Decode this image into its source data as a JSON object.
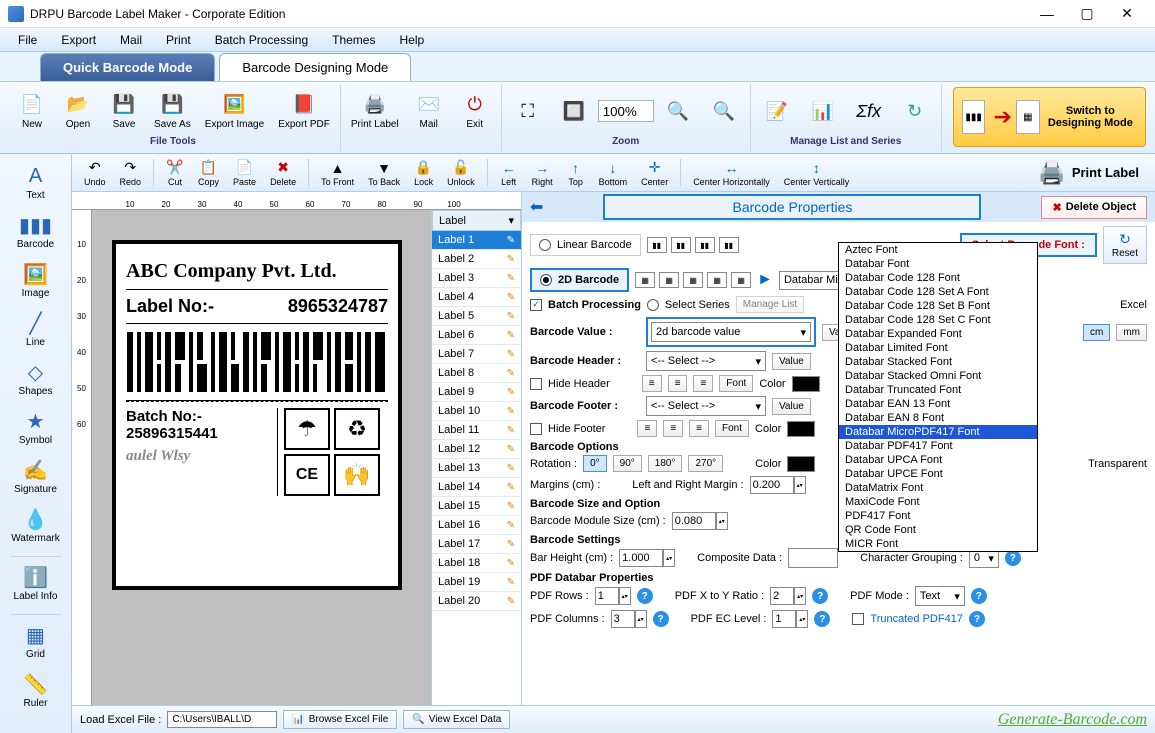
{
  "app": {
    "title": "DRPU Barcode Label Maker - Corporate Edition"
  },
  "menubar": [
    "File",
    "Export",
    "Mail",
    "Print",
    "Batch Processing",
    "Themes",
    "Help"
  ],
  "modetabs": {
    "quick": "Quick Barcode Mode",
    "design": "Barcode Designing Mode"
  },
  "ribbon": {
    "new": "New",
    "open": "Open",
    "save": "Save",
    "saveas": "Save As",
    "exportimg": "Export Image",
    "exportpdf": "Export PDF",
    "printlabel": "Print Label",
    "mail": "Mail",
    "exit": "Exit",
    "filetools": "File Tools",
    "zoom": "Zoom",
    "zoomval": "100%",
    "managelist": "Manage List and Series",
    "switch": "Switch to Designing Mode"
  },
  "toolbar2": {
    "undo": "Undo",
    "redo": "Redo",
    "cut": "Cut",
    "copy": "Copy",
    "paste": "Paste",
    "delete": "Delete",
    "tofront": "To Front",
    "toback": "To Back",
    "lock": "Lock",
    "unlock": "Unlock",
    "left": "Left",
    "right": "Right",
    "top": "Top",
    "bottom": "Bottom",
    "center": "Center",
    "centerh": "Center Horizontally",
    "centerv": "Center Vertically",
    "printlabel": "Print Label"
  },
  "lefttools": [
    "Text",
    "Barcode",
    "Image",
    "Line",
    "Shapes",
    "Symbol",
    "Signature",
    "Watermark",
    "Label Info",
    "Grid",
    "Ruler"
  ],
  "ruler_h": [
    "10",
    "20",
    "30",
    "40",
    "50",
    "60",
    "70",
    "80",
    "90",
    "100"
  ],
  "ruler_v": [
    "10",
    "20",
    "30",
    "40",
    "50",
    "60"
  ],
  "label": {
    "company": "ABC Company Pvt. Ltd.",
    "labelno_lbl": "Label No:-",
    "labelno": "8965324787",
    "batchno_lbl": "Batch No:-",
    "batchno": "25896315441"
  },
  "labellist": {
    "header": "Label",
    "items": [
      "Label 1",
      "Label 2",
      "Label 3",
      "Label 4",
      "Label 5",
      "Label 6",
      "Label 7",
      "Label 8",
      "Label 9",
      "Label 10",
      "Label 11",
      "Label 12",
      "Label 13",
      "Label 14",
      "Label 15",
      "Label 16",
      "Label 17",
      "Label 18",
      "Label 19",
      "Label 20"
    ],
    "selected": 0
  },
  "props": {
    "title": "Barcode Properties",
    "delete": "Delete Object",
    "linear": "Linear Barcode",
    "twod": "2D Barcode",
    "selectfont": "Select Barcode Font :",
    "fontcombo": "Databar MicroPDF417 Font",
    "reset": "Reset",
    "batch": "Batch Processing",
    "selseries": "Select Series",
    "managelist": "Manage List",
    "excel": "Excel",
    "barcodeval_lbl": "Barcode Value :",
    "barcodeval": "2d barcode value",
    "header_lbl": "Barcode Header :",
    "header_sel": "<-- Select -->",
    "footer_lbl": "Barcode Footer :",
    "footer_sel": "<-- Select -->",
    "hideheader": "Hide Header",
    "hidefooter": "Hide Footer",
    "font": "Font",
    "color": "Color",
    "value": "Value",
    "options": "Barcode Options",
    "rotation": "Rotation :",
    "rot0": "0°",
    "rot90": "90°",
    "rot180": "180°",
    "rot270": "270°",
    "transparent": "Transparent",
    "margins_lbl": "Margins (cm) :",
    "margins_side": "Left and Right Margin :",
    "margins_val": "0.200",
    "cm": "cm",
    "mm": "mm",
    "size": "Barcode Size and Option",
    "modsize": "Barcode Module Size (cm) :",
    "modsize_val": "0.080",
    "settings": "Barcode Settings",
    "barheight": "Bar Height (cm) :",
    "barheight_val": "1.000",
    "compdata": "Composite Data :",
    "chargroup": "Character Grouping :",
    "chargroup_val": "0",
    "pdfprops": "PDF Databar Properties",
    "pdfrows": "PDF Rows :",
    "pdfrows_val": "1",
    "pdfcols": "PDF Columns :",
    "pdfcols_val": "3",
    "pdfratio": "PDF X to Y Ratio :",
    "pdfratio_val": "2",
    "pdfec": "PDF EC Level :",
    "pdfec_val": "1",
    "pdfmode": "PDF Mode :",
    "pdfmode_val": "Text",
    "truncated": "Truncated PDF417"
  },
  "fontlist": {
    "items": [
      "Aztec Font",
      "Databar Font",
      "Databar Code 128 Font",
      "Databar Code 128 Set A Font",
      "Databar Code 128 Set B Font",
      "Databar Code 128 Set C Font",
      "Databar Expanded Font",
      "Databar Limited Font",
      "Databar Stacked Font",
      "Databar Stacked Omni Font",
      "Databar Truncated Font",
      "Databar EAN 13 Font",
      "Databar EAN 8 Font",
      "Databar MicroPDF417 Font",
      "Databar PDF417 Font",
      "Databar UPCA Font",
      "Databar UPCE Font",
      "DataMatrix Font",
      "MaxiCode Font",
      "PDF417 Font",
      "QR Code Font",
      "MICR Font"
    ],
    "selected": 13
  },
  "footer": {
    "loadexcel": "Load Excel File :",
    "path": "C:\\Users\\IBALL\\D",
    "browse": "Browse Excel File",
    "view": "View Excel Data",
    "brand": "Generate-Barcode.com"
  }
}
